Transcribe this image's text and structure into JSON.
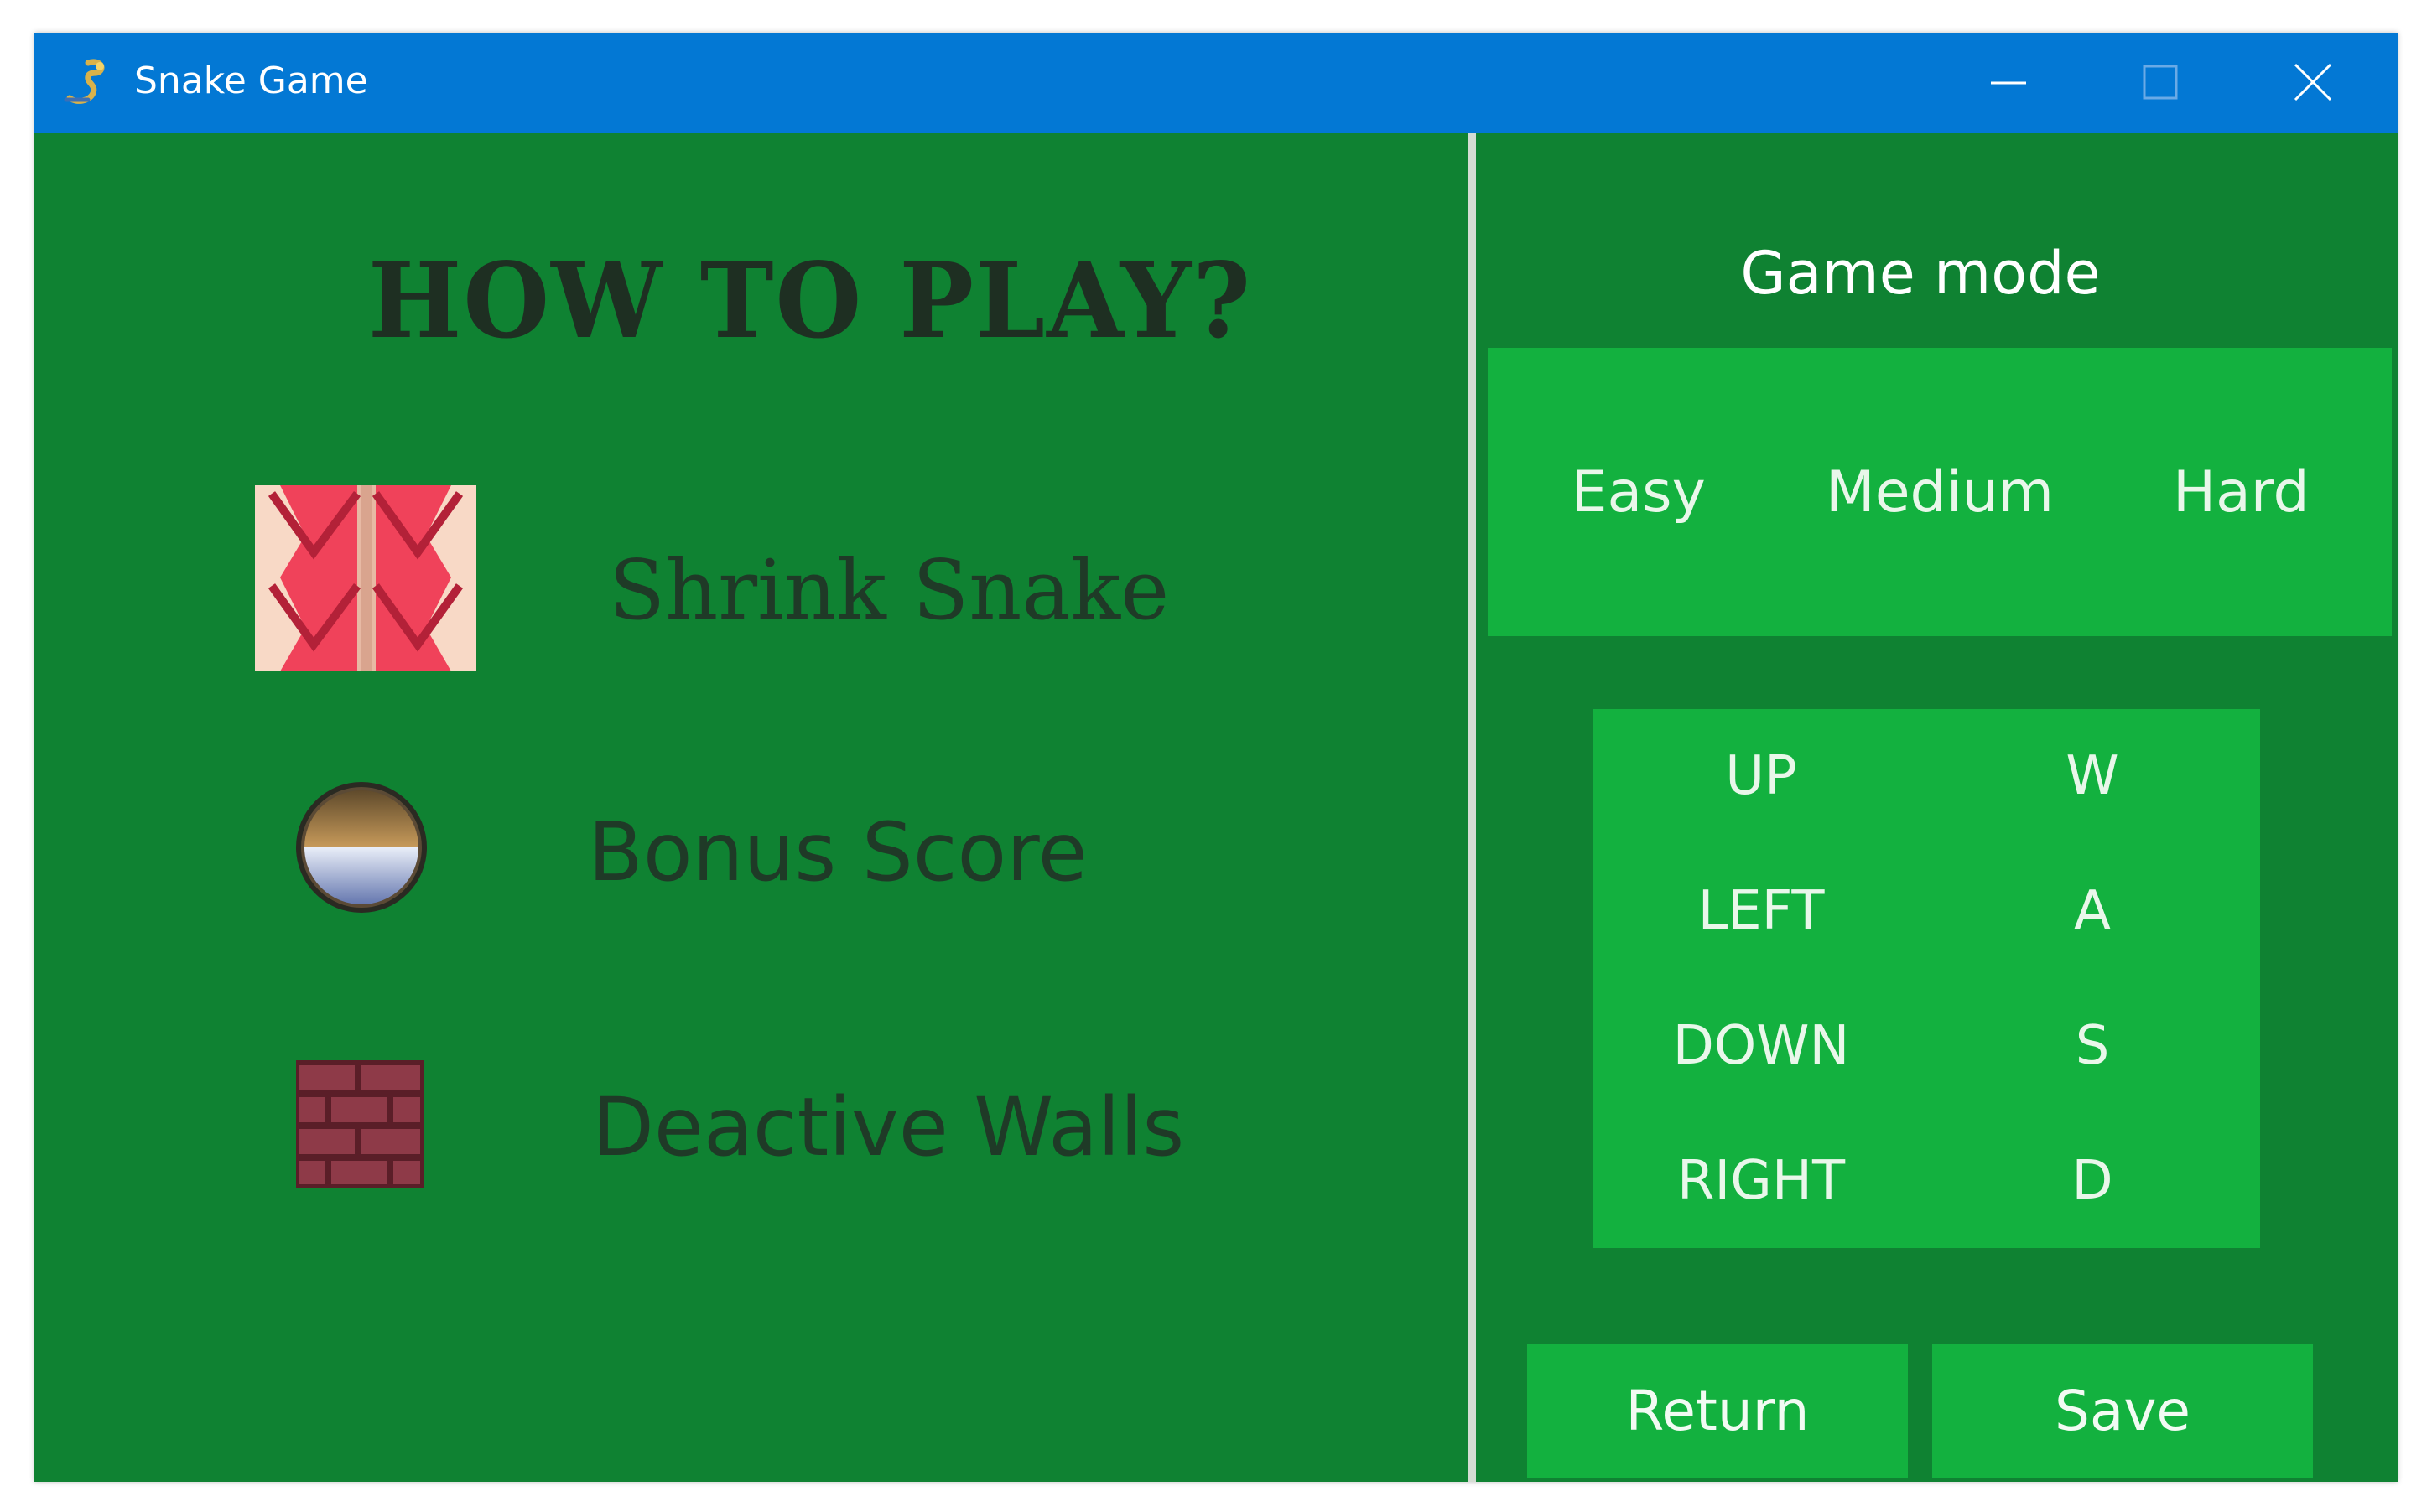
{
  "window": {
    "title": "Snake Game",
    "app_icon": "snake-app-icon",
    "controls": [
      "minimize-icon",
      "maximize-icon",
      "close-icon"
    ]
  },
  "how_to_play": {
    "title": "HOW TO PLAY?",
    "items": [
      {
        "icon": "shrink-snake-icon",
        "label": "Shrink Snake"
      },
      {
        "icon": "bonus-score-icon",
        "label": "Bonus Score"
      },
      {
        "icon": "brick-wall-icon",
        "label": "Deactive Walls"
      }
    ]
  },
  "game_mode": {
    "title": "Game mode",
    "options": [
      "Easy",
      "Medium",
      "Hard"
    ]
  },
  "controls": [
    {
      "direction": "UP",
      "key": "W"
    },
    {
      "direction": "LEFT",
      "key": "A"
    },
    {
      "direction": "DOWN",
      "key": "S"
    },
    {
      "direction": "RIGHT",
      "key": "D"
    }
  ],
  "buttons": {
    "return_label": "Return",
    "save_label": "Save"
  },
  "colors": {
    "titlebar": "#0378d4",
    "background": "#0f8232",
    "panel": "#13b13f",
    "divider": "#d4dcd3"
  }
}
